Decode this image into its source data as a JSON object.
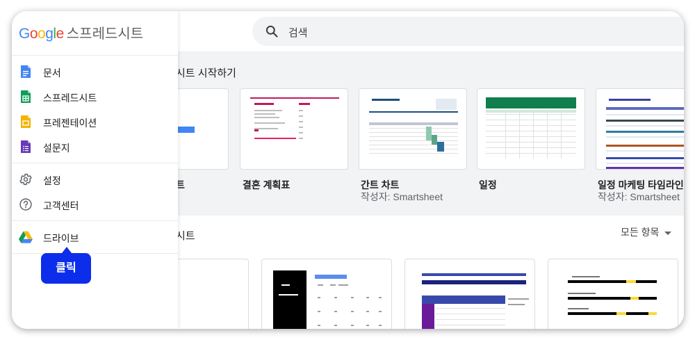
{
  "brand": {
    "letters": [
      "G",
      "o",
      "o",
      "g",
      "l",
      "e"
    ],
    "app_name": "스프레드시트"
  },
  "search": {
    "placeholder": "검색"
  },
  "drawer": {
    "apps": [
      {
        "label": "문서",
        "icon": "docs-icon"
      },
      {
        "label": "스프레드시트",
        "icon": "sheets-icon"
      },
      {
        "label": "프레젠테이션",
        "icon": "slides-icon"
      },
      {
        "label": "설문지",
        "icon": "forms-icon"
      }
    ],
    "settings": [
      {
        "label": "설정",
        "icon": "gear-icon"
      },
      {
        "label": "고객센터",
        "icon": "help-icon"
      }
    ],
    "drive": {
      "label": "드라이브",
      "icon": "drive-icon"
    }
  },
  "callout": {
    "label": "클릭"
  },
  "templates": {
    "title": "시트 시작하기",
    "items": [
      {
        "name": "트",
        "sub": ""
      },
      {
        "name": "결혼 계획표",
        "sub": ""
      },
      {
        "name": "간트 차트",
        "sub": "작성자: Smartsheet"
      },
      {
        "name": "일정",
        "sub": ""
      },
      {
        "name": "일정 마케팅 타임라인",
        "sub": "작성자: Smartsheet"
      }
    ]
  },
  "recent": {
    "title": "시트",
    "filter_label": "모든 항목"
  },
  "colors": {
    "google_blue": "#4285f4",
    "google_red": "#ea4335",
    "google_yellow": "#fbbc05",
    "google_green": "#34a853",
    "callout": "#0c2eea",
    "template_bg": "#f1f3f4"
  }
}
